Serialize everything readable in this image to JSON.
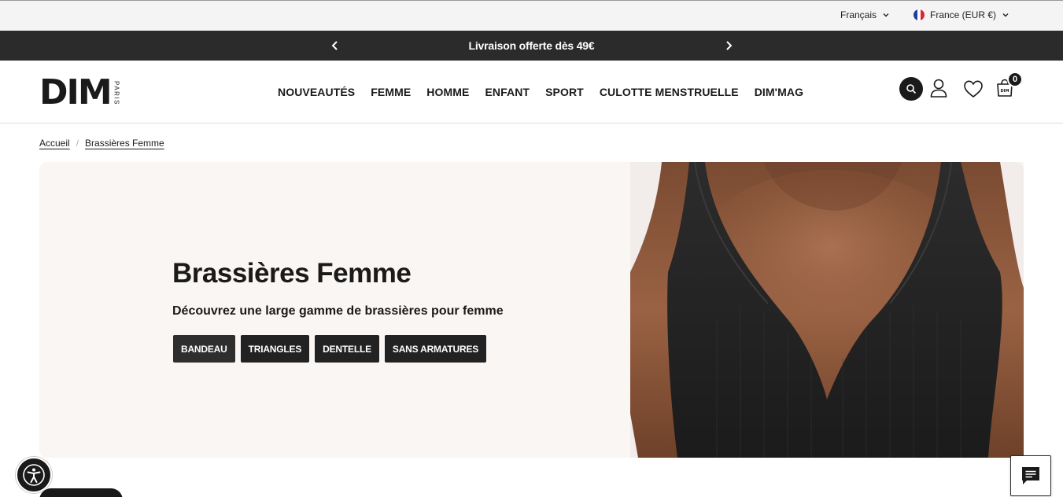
{
  "utility": {
    "language": "Français",
    "country": "France (EUR €)"
  },
  "announcement": {
    "text": "Livraison offerte dès 49€"
  },
  "header": {
    "logo_main": "DIM",
    "logo_sub": "PARIS",
    "nav": [
      "NOUVEAUTÉS",
      "FEMME",
      "HOMME",
      "ENFANT",
      "SPORT",
      "CULOTTE MENSTRUELLE",
      "DIM'MAG"
    ],
    "cart_count": "0",
    "cart_label": "DIM"
  },
  "breadcrumb": [
    "Accueil",
    "Brassières Femme"
  ],
  "hero": {
    "title": "Brassières Femme",
    "subtitle": "Découvrez une large gamme de brassières pour femme",
    "chips": [
      "BANDEAU",
      "TRIANGLES",
      "DENTELLE",
      "SANS ARMATURES"
    ]
  },
  "colors": {
    "announce_bg": "#2b2b2b",
    "hero_bg": "#faf6f3",
    "chip_bg": "#222222",
    "flag_blue": "#1f3fa0",
    "flag_red": "#d8263a"
  }
}
